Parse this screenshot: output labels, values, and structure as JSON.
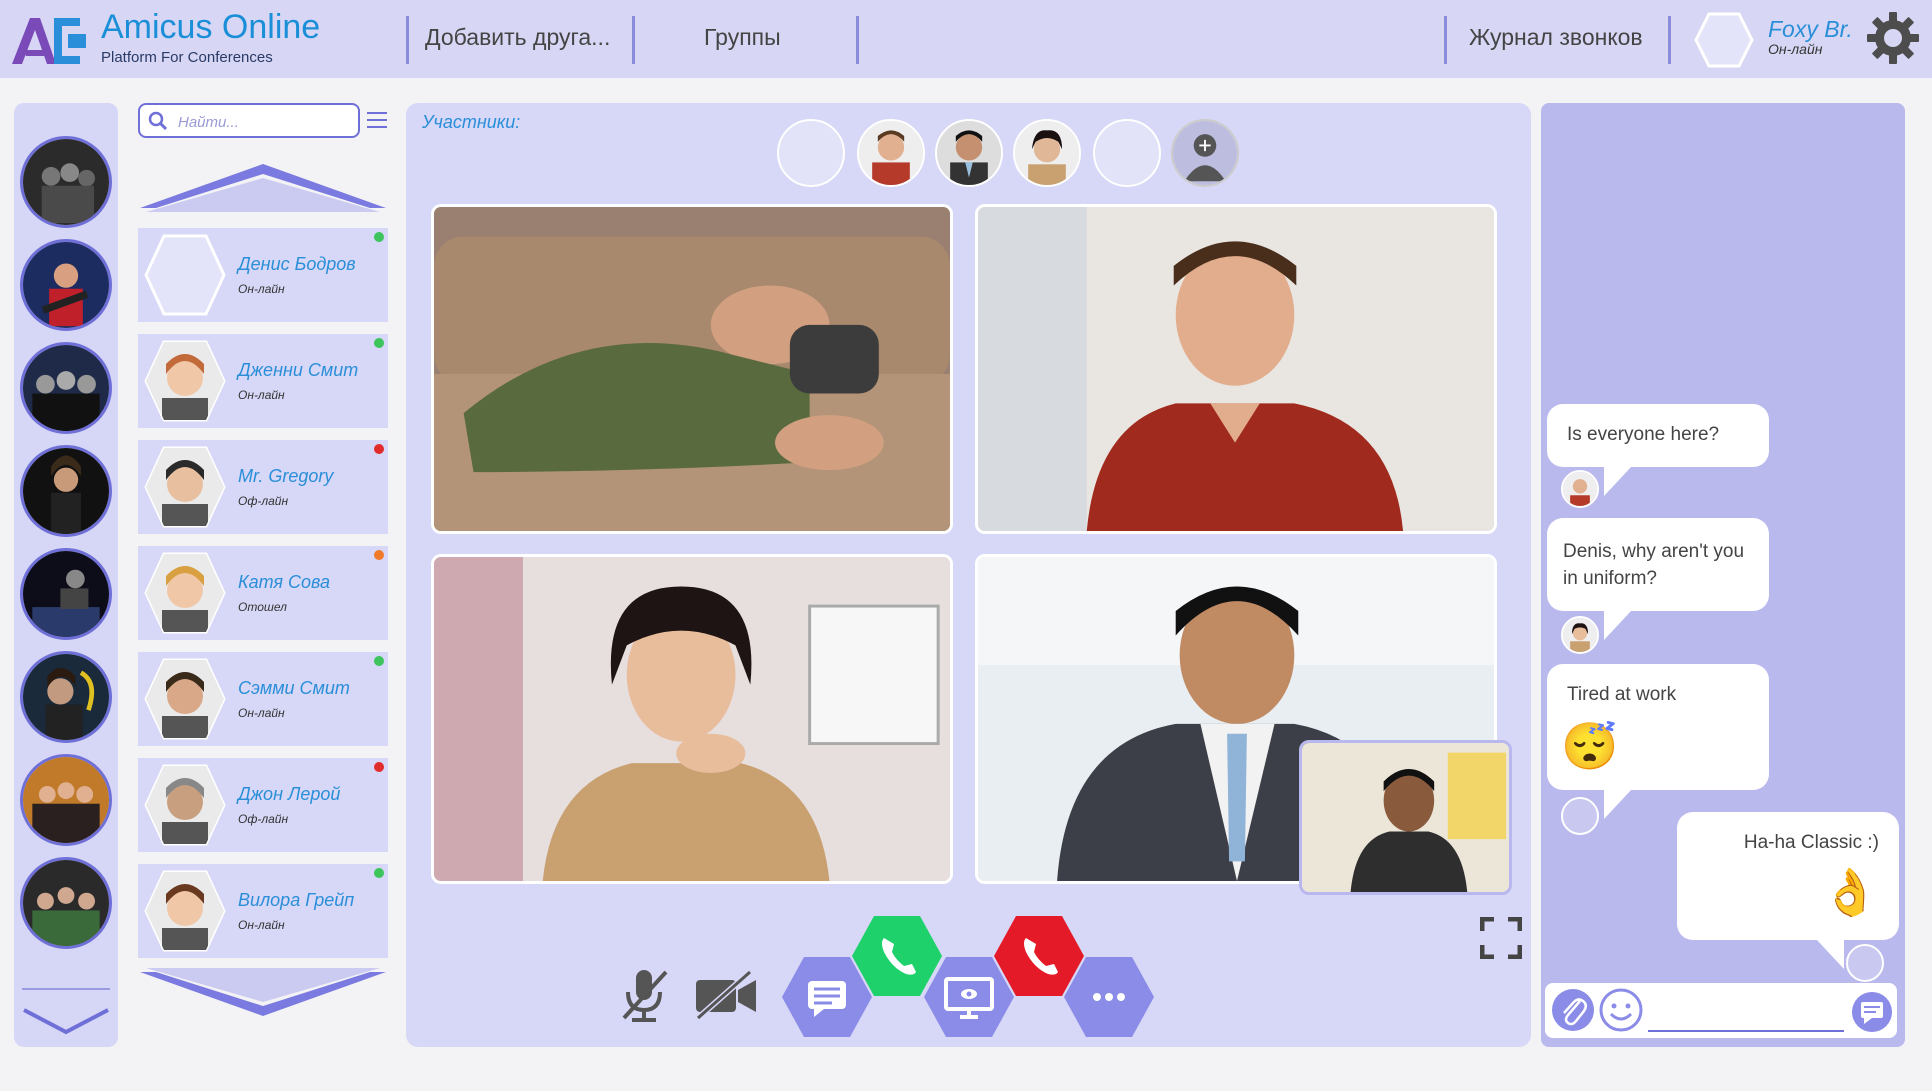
{
  "app": {
    "name": "Amicus Online",
    "tagline": "Platform For Conferences",
    "logo_letters": "AO"
  },
  "nav": {
    "add_friend": "Добавить друга...",
    "groups": "Группы",
    "call_log": "Журнал звонков"
  },
  "user": {
    "name": "Foxy Br.",
    "status": "Он-лайн"
  },
  "search": {
    "placeholder": "Найти..."
  },
  "groups_rail": {
    "items": [
      "band-1",
      "band-2",
      "band-3",
      "band-4",
      "band-5",
      "band-6",
      "band-7",
      "band-8"
    ]
  },
  "contacts": [
    {
      "name": "Денис Бодров",
      "status": "Он-лайн",
      "presence_color": "#3ec45c"
    },
    {
      "name": "Дженни Смит",
      "status": "Он-лайн",
      "presence_color": "#3ec45c"
    },
    {
      "name": "Mr. Gregory",
      "status": "Оф-лайн",
      "presence_color": "#e22b2b"
    },
    {
      "name": "Катя Сова",
      "status": "Отошел",
      "presence_color": "#f07a2a"
    },
    {
      "name": "Сэмми Смит",
      "status": "Он-лайн",
      "presence_color": "#3ec45c"
    },
    {
      "name": "Джон Лерой",
      "status": "Оф-лайн",
      "presence_color": "#e22b2b"
    },
    {
      "name": "Вилора Грейп",
      "status": "Он-лайн",
      "presence_color": "#3ec45c"
    }
  ],
  "call": {
    "participants_label": "Участники:",
    "participants": [
      "empty-slot",
      "participant-red-shirt",
      "participant-suit",
      "participant-woman",
      "empty-slot",
      "add-participant"
    ],
    "video_tiles": [
      "sleeping-man",
      "man-red-shirt",
      "woman-smiling",
      "man-in-suit"
    ],
    "self_view": "self-camera"
  },
  "controls": {
    "mic": "mic-muted",
    "camera": "camera-off",
    "chat": "chat",
    "accept": "phone-accept",
    "screen_share": "screen-share",
    "hang_up": "phone-hangup",
    "more": "more"
  },
  "chat": {
    "messages": [
      {
        "text": "Is everyone here?",
        "side": "left",
        "avatar": "man-red-shirt"
      },
      {
        "text": "Denis, why aren't you in uniform?",
        "side": "left",
        "avatar": "woman"
      },
      {
        "text": "Tired at work",
        "side": "left",
        "avatar": "empty",
        "emoji": "😴"
      },
      {
        "text": "Ha-ha Classic :)",
        "side": "right",
        "avatar": "empty",
        "emoji": "👌"
      }
    ],
    "input_value": ""
  },
  "colors": {
    "header_bg": "#d7d7f5",
    "panel_bg": "#d7d7f7",
    "accent": "#6f6fd8",
    "link_blue": "#2a8fd8",
    "accept_green": "#1fd16b",
    "hangup_red": "#e51a28",
    "hex_blue": "#8b8be8"
  }
}
